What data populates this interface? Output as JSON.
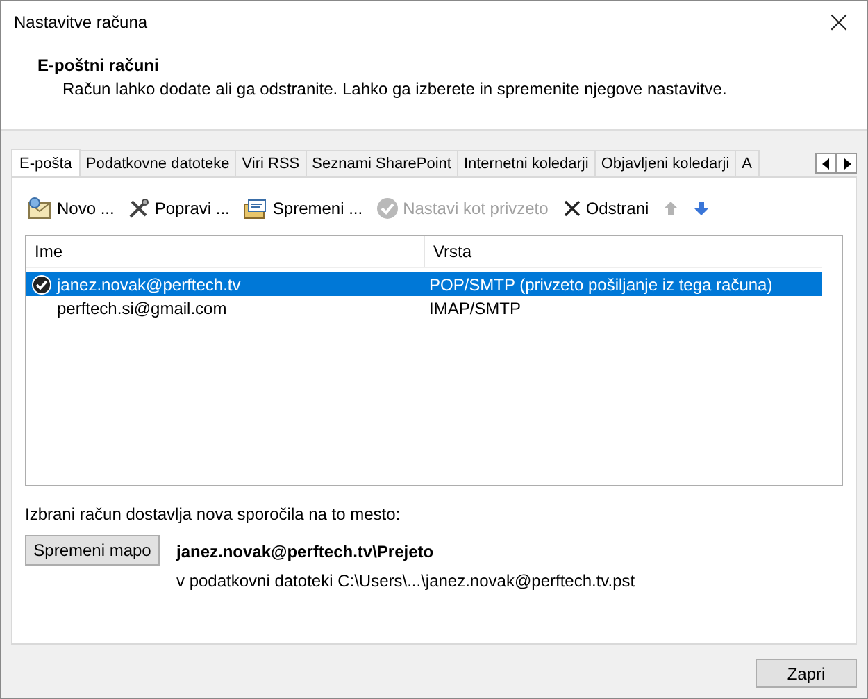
{
  "window": {
    "title": "Nastavitve računa",
    "close": "×"
  },
  "header": {
    "title": "E-poštni računi",
    "description": "Račun lahko dodate ali ga odstranite. Lahko ga izberete in spremenite njegove nastavitve."
  },
  "tabs": [
    {
      "label": "E-pošta",
      "selected": true
    },
    {
      "label": "Podatkovne datoteke",
      "selected": false
    },
    {
      "label": "Viri RSS",
      "selected": false
    },
    {
      "label": "Seznami SharePoint",
      "selected": false
    },
    {
      "label": "Internetni koledarji",
      "selected": false
    },
    {
      "label": "Objavljeni koledarji",
      "selected": false
    },
    {
      "label": "A",
      "selected": false
    }
  ],
  "toolbar": [
    {
      "kind": "new",
      "label": "Novo ...",
      "disabled": false
    },
    {
      "kind": "repair",
      "label": "Popravi ...",
      "disabled": false
    },
    {
      "kind": "change",
      "label": "Spremeni ...",
      "disabled": false
    },
    {
      "kind": "default",
      "label": "Nastavi kot privzeto",
      "disabled": true
    },
    {
      "kind": "remove",
      "label": "Odstrani",
      "disabled": false
    },
    {
      "kind": "up",
      "disabled": true
    },
    {
      "kind": "down",
      "disabled": false
    }
  ],
  "table": {
    "columns": [
      "Ime",
      "Vrsta"
    ],
    "rows": [
      {
        "name": "janez.novak@perftech.tv",
        "type": "POP/SMTP (privzeto pošiljanje iz tega računa)",
        "selected": true,
        "default": true
      },
      {
        "name": "perftech.si@gmail.com",
        "type": "IMAP/SMTP",
        "selected": false,
        "default": false
      }
    ]
  },
  "delivery": {
    "label": "Izbrani račun dostavlja nova sporočila na to mesto:",
    "button": "Spremeni mapo",
    "folder": "janez.novak@perftech.tv\\Prejeto",
    "file": "v podatkovni datoteki C:\\Users\\...\\janez.novak@perftech.tv.pst"
  },
  "buttons": [
    "Zapri"
  ]
}
